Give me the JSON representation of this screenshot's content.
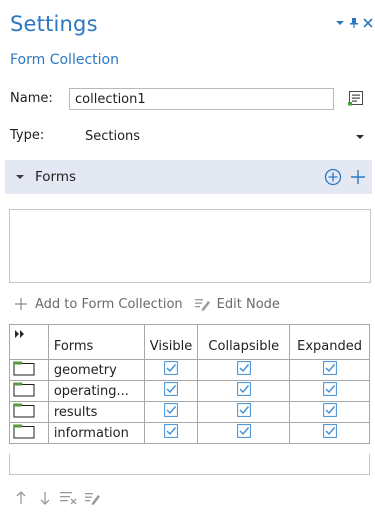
{
  "panel": {
    "title": "Settings",
    "subtitle": "Form Collection"
  },
  "window_controls": {
    "menu_icon": "chevron-down-icon",
    "pin_icon": "pin-icon",
    "close_icon": "close-icon"
  },
  "name_field": {
    "label": "Name:",
    "value": "collection1",
    "button_icon": "select-node-icon"
  },
  "type_field": {
    "label": "Type:",
    "selected": "Sections"
  },
  "forms_section": {
    "title": "Forms",
    "add_circle_icon": "add-circle-icon",
    "add_icon": "plus-icon"
  },
  "toolbar": {
    "add_label": "Add to Form Collection",
    "edit_label": "Edit Node"
  },
  "table": {
    "headers": [
      "Forms",
      "Visible",
      "Collapsible",
      "Expanded"
    ],
    "rows": [
      {
        "name": "geometry",
        "visible": true,
        "collapsible": true,
        "expanded": true
      },
      {
        "name": "operating...",
        "visible": true,
        "collapsible": true,
        "expanded": true
      },
      {
        "name": "results",
        "visible": true,
        "collapsible": true,
        "expanded": true
      },
      {
        "name": "information",
        "visible": true,
        "collapsible": true,
        "expanded": true
      }
    ]
  },
  "bottom_toolbar": {
    "icons": [
      "move-up-icon",
      "move-down-icon",
      "clear-table-icon",
      "edit-icon"
    ]
  },
  "colors": {
    "accent": "#2b78c2",
    "section_bg": "#e3e8f2",
    "checkbox": "#3f8fd6",
    "folder": "#5a9a3c"
  }
}
